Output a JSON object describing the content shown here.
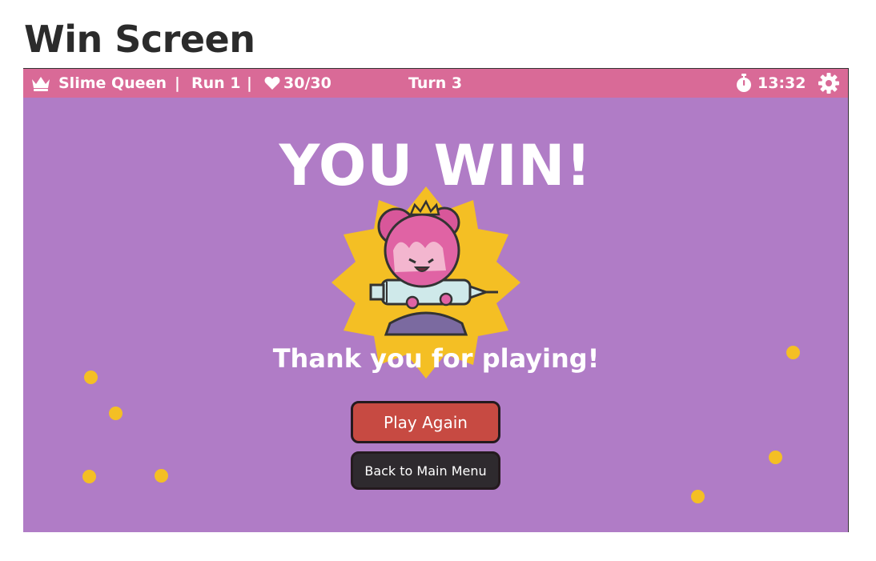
{
  "page": {
    "heading": "Win Screen"
  },
  "hud": {
    "character_name": "Slime Queen",
    "separator": "|",
    "run": "Run 1",
    "health": "30/30",
    "turn": "Turn 3",
    "timer": "13:32",
    "icons": [
      "crown-icon",
      "heart-icon",
      "stopwatch-icon",
      "gear-icon"
    ]
  },
  "result": {
    "title": "YOU WIN!",
    "message": "Thank you for playing!"
  },
  "buttons": {
    "play_again": "Play Again",
    "main_menu": "Back to Main Menu"
  },
  "colors": {
    "background": "#b07cc6",
    "hud": "#d96a97",
    "accent_yellow": "#f4bf24",
    "play_button": "#c74a42",
    "menu_button": "#2e2a2e"
  }
}
